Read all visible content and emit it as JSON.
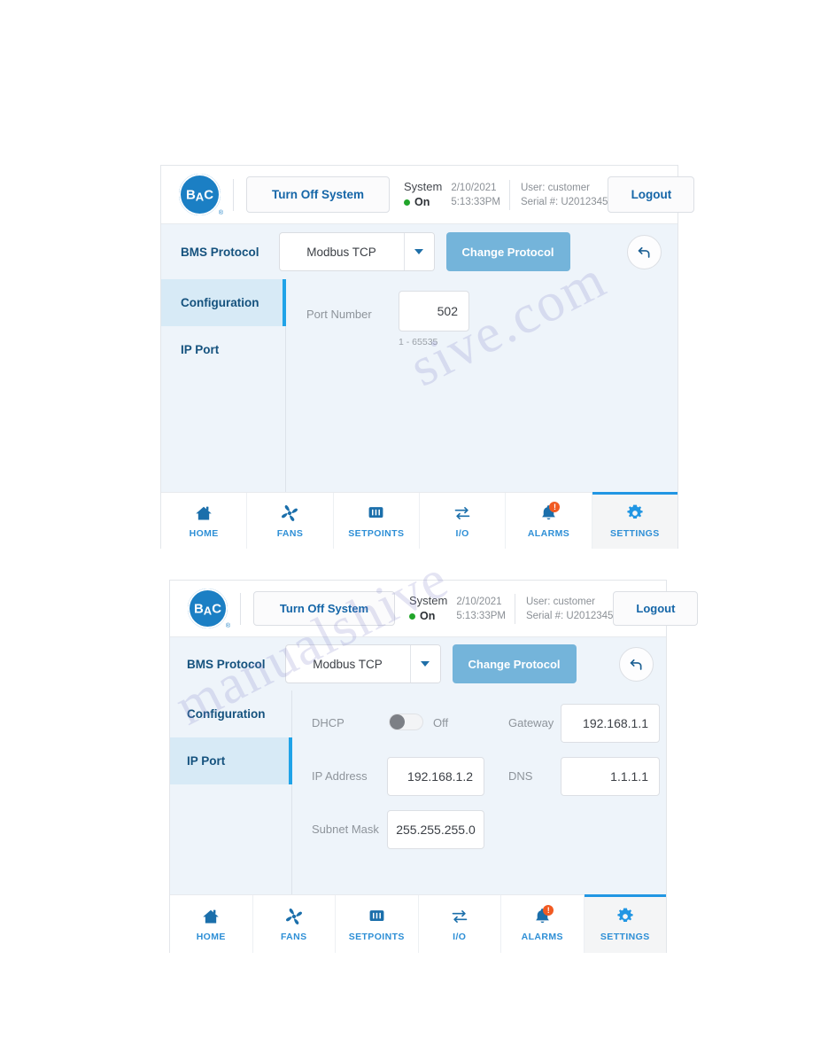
{
  "watermark": {
    "line1": "sive.com",
    "line2": "manualshive"
  },
  "colors": {
    "brand_blue": "#1b7fc4",
    "accent_blue": "#2196e3",
    "panel_bg": "#eef4fa",
    "active_tab": "#d7eaf6",
    "button_blue": "#74b4da",
    "status_green": "#21a52a",
    "alarm_orange": "#f15a22"
  },
  "header": {
    "logo_text_left": "B",
    "logo_text_mid": "A",
    "logo_text_right": "C",
    "logo_registered": "®",
    "turn_off_label": "Turn Off System",
    "system_label": "System",
    "system_state": "On",
    "date": "2/10/2021",
    "time": "5:13:33PM",
    "user": "User: customer",
    "serial": "Serial #: U2012345",
    "logout_label": "Logout"
  },
  "protocol_row": {
    "label": "BMS Protocol",
    "selected": "Modbus TCP",
    "change_label": "Change Protocol",
    "undo_icon": "undo-arrow-icon"
  },
  "sidebar": {
    "items": [
      {
        "label": "Configuration"
      },
      {
        "label": "IP Port"
      }
    ]
  },
  "panel_a": {
    "active_sidebar_index": 0,
    "port_number": {
      "label": "Port Number",
      "value": "502",
      "hint": "1 - 65535"
    }
  },
  "panel_b": {
    "active_sidebar_index": 1,
    "dhcp": {
      "label": "DHCP",
      "state": "Off",
      "on": false
    },
    "ip_address": {
      "label": "IP Address",
      "value": "192.168.1.2"
    },
    "subnet_mask": {
      "label": "Subnet Mask",
      "value": "255.255.255.0"
    },
    "gateway": {
      "label": "Gateway",
      "value": "192.168.1.1"
    },
    "dns": {
      "label": "DNS",
      "value": "1.1.1.1"
    }
  },
  "nav": {
    "items": [
      {
        "label": "HOME",
        "icon": "home-icon",
        "active": false
      },
      {
        "label": "FANS",
        "icon": "fan-icon",
        "active": false
      },
      {
        "label": "SETPOINTS",
        "icon": "sliders-icon",
        "active": false
      },
      {
        "label": "I/O",
        "icon": "io-arrows-icon",
        "active": false
      },
      {
        "label": "ALARMS",
        "icon": "bell-icon",
        "active": false,
        "badge": "!"
      },
      {
        "label": "SETTINGS",
        "icon": "gear-icon",
        "active": true
      }
    ]
  }
}
